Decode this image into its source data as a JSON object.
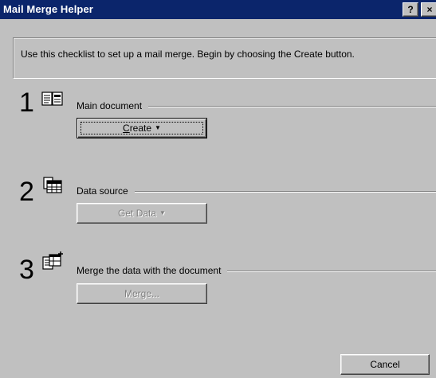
{
  "window": {
    "title": "Mail Merge Helper",
    "help_label": "?",
    "close_label": "×"
  },
  "intro": {
    "text": "Use this checklist to set up a mail merge. Begin by choosing the Create button."
  },
  "steps": [
    {
      "number": "1",
      "label": "Main document",
      "icon": "main-document-icon",
      "button": {
        "mnemonic": "C",
        "rest": "reate",
        "arrow": "▼",
        "enabled": true
      }
    },
    {
      "number": "2",
      "label": "Data source",
      "icon": "data-source-icon",
      "button": {
        "label": "Get Data",
        "arrow": "▼",
        "enabled": false
      }
    },
    {
      "number": "3",
      "label": "Merge the data with the document",
      "icon": "merge-icon",
      "button": {
        "label": "Merge...",
        "enabled": false
      }
    }
  ],
  "footer": {
    "cancel_label": "Cancel"
  }
}
